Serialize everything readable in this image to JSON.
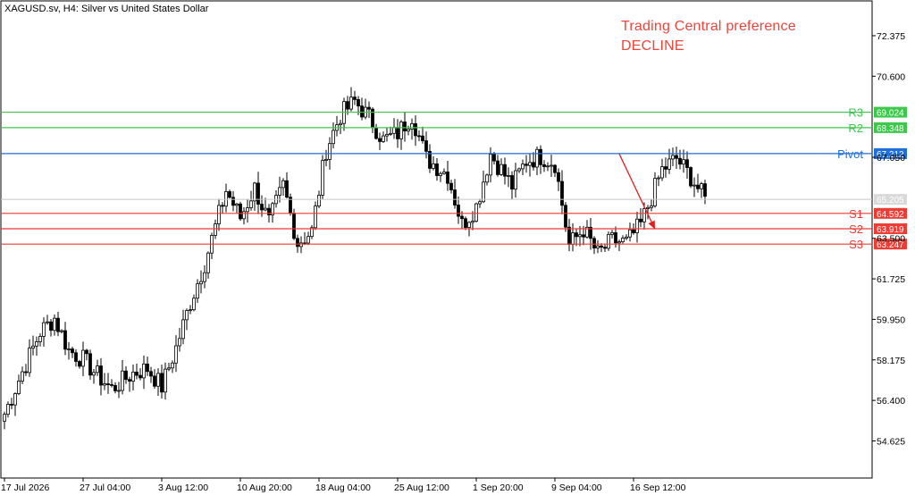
{
  "header": {
    "symbol": "XAGUSD.sv, H4:  Silver vs United States Dollar",
    "preference_line1": "Trading Central preference",
    "preference_line2": "DECLINE"
  },
  "colors": {
    "preference": "#f0443a",
    "resistance": "#3cc84b",
    "pivot": "#1e6fd9",
    "support": "#ee3b33",
    "current": "#c8c8c8",
    "arrow": "#e02020",
    "candle": "#000000"
  },
  "chart_data": {
    "type": "candlestick",
    "y_ticks": [
      "72.375",
      "70.600",
      "67.050",
      "63.500",
      "61.725",
      "59.950",
      "58.175",
      "56.400",
      "54.625"
    ],
    "x_ticks": [
      "17 Jul 2026",
      "27 Jul 04:00",
      "3 Aug 12:00",
      "10 Aug 20:00",
      "18 Aug 04:00",
      "25 Aug 12:00",
      "1 Sep 20:00",
      "9 Sep 04:00",
      "16 Sep 12:00"
    ],
    "ylim": [
      53.0,
      73.9
    ],
    "levels": [
      {
        "name": "R3",
        "value": 69.024,
        "label": "69.024",
        "kind": "resistance"
      },
      {
        "name": "R2",
        "value": 68.348,
        "label": "68.348",
        "kind": "resistance"
      },
      {
        "name": "Pivot",
        "value": 67.212,
        "label": "67.212",
        "kind": "pivot"
      },
      {
        "name": "S1",
        "value": 64.592,
        "label": "64.592",
        "kind": "support"
      },
      {
        "name": "S2",
        "value": 63.919,
        "label": "63.919",
        "kind": "support"
      },
      {
        "name": "S3",
        "value": 63.247,
        "label": "63.247",
        "kind": "support"
      }
    ],
    "current_price": {
      "value": 65.205,
      "label": "65.205"
    },
    "forecast_arrow": {
      "from_bar": 172,
      "from_value": 67.2,
      "to_bar": 182,
      "to_value": 63.9
    },
    "bars_total": 197,
    "anchors": [
      [
        0,
        55.8
      ],
      [
        4,
        57.3
      ],
      [
        10,
        59.4
      ],
      [
        14,
        60.0
      ],
      [
        18,
        58.6
      ],
      [
        22,
        58.2
      ],
      [
        26,
        57.5
      ],
      [
        30,
        56.9
      ],
      [
        36,
        57.6
      ],
      [
        40,
        57.8
      ],
      [
        44,
        57.0
      ],
      [
        48,
        58.7
      ],
      [
        52,
        60.7
      ],
      [
        56,
        62.4
      ],
      [
        62,
        65.6
      ],
      [
        66,
        64.4
      ],
      [
        70,
        65.7
      ],
      [
        74,
        64.2
      ],
      [
        78,
        65.8
      ],
      [
        82,
        63.3
      ],
      [
        86,
        63.8
      ],
      [
        90,
        67.4
      ],
      [
        94,
        68.9
      ],
      [
        98,
        69.5
      ],
      [
        102,
        68.8
      ],
      [
        106,
        67.8
      ],
      [
        110,
        68.1
      ],
      [
        114,
        68.9
      ],
      [
        118,
        67.0
      ],
      [
        124,
        66.3
      ],
      [
        128,
        64.1
      ],
      [
        132,
        64.9
      ],
      [
        136,
        67.2
      ],
      [
        142,
        65.8
      ],
      [
        146,
        66.9
      ],
      [
        150,
        67.1
      ],
      [
        154,
        66.8
      ],
      [
        158,
        63.2
      ],
      [
        162,
        63.9
      ],
      [
        166,
        62.8
      ],
      [
        170,
        63.4
      ],
      [
        174,
        63.3
      ],
      [
        178,
        64.1
      ],
      [
        184,
        66.5
      ],
      [
        188,
        67.0
      ],
      [
        192,
        66.2
      ],
      [
        196,
        65.2
      ]
    ]
  }
}
